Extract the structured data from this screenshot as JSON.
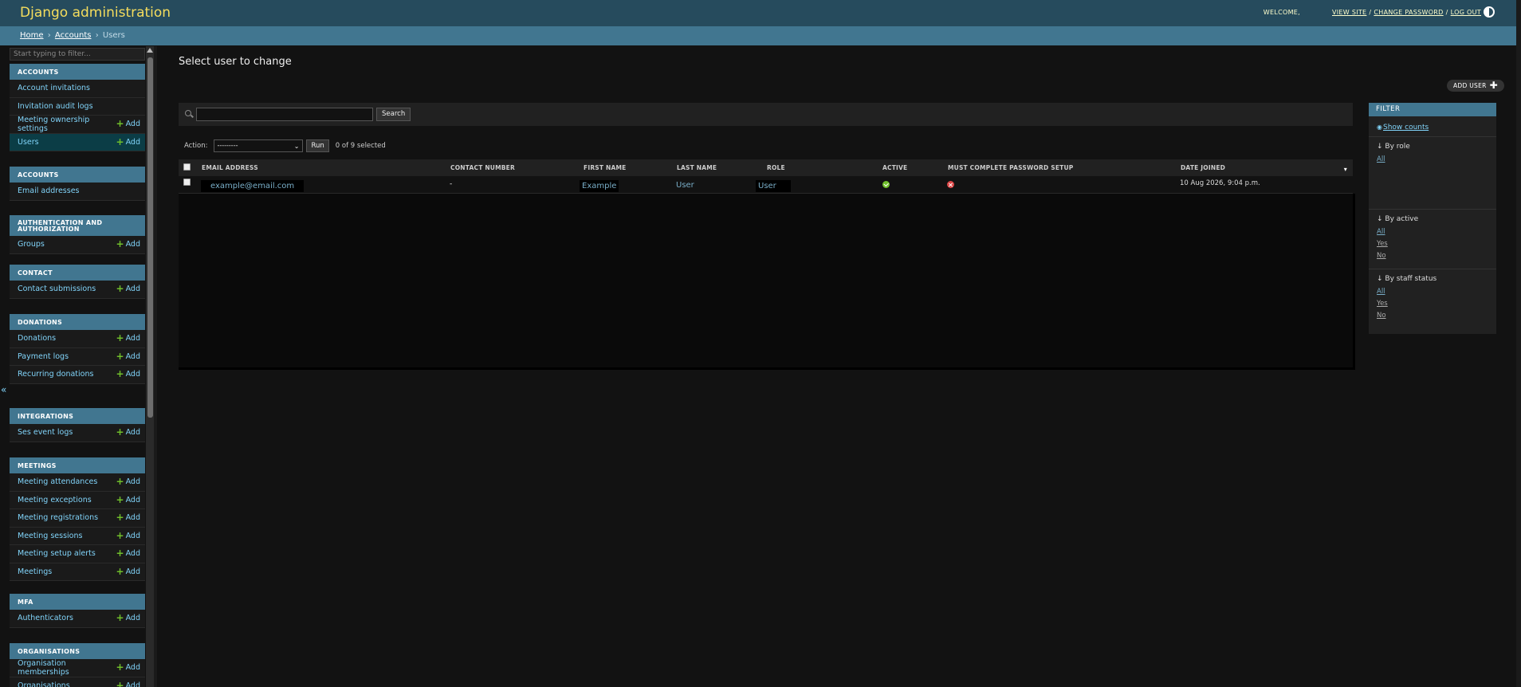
{
  "header": {
    "branding": "Django administration",
    "welcome": "WELCOME,",
    "view_site": "VIEW SITE",
    "change_password": "CHANGE PASSWORD",
    "log_out": "LOG OUT",
    "sep": "/"
  },
  "breadcrumbs": {
    "home": "Home",
    "accounts": "Accounts",
    "current": "Users",
    "arrow": "›"
  },
  "sidebar": {
    "filter_placeholder": "Start typing to filter...",
    "add_label": "Add",
    "toggle_icon": "«",
    "modules": [
      {
        "caption": "Accounts",
        "items": [
          {
            "label": "Account invitations",
            "add": false
          },
          {
            "label": "Invitation audit logs",
            "add": false
          },
          {
            "label": "Meeting ownership settings",
            "add": true
          },
          {
            "label": "Users",
            "add": true,
            "current": true
          }
        ]
      },
      {
        "caption": "Accounts",
        "items": [
          {
            "label": "Email addresses",
            "add": false
          }
        ]
      },
      {
        "caption": "Authentication and Authorization",
        "items": [
          {
            "label": "Groups",
            "add": true
          }
        ]
      },
      {
        "caption": "Contact",
        "items": [
          {
            "label": "Contact submissions",
            "add": true
          }
        ]
      },
      {
        "caption": "Donations",
        "items": [
          {
            "label": "Donations",
            "add": true
          },
          {
            "label": "Payment logs",
            "add": true
          },
          {
            "label": "Recurring donations",
            "add": true
          }
        ]
      },
      {
        "caption": "Integrations",
        "items": [
          {
            "label": "Ses event logs",
            "add": true
          }
        ]
      },
      {
        "caption": "Meetings",
        "items": [
          {
            "label": "Meeting attendances",
            "add": true
          },
          {
            "label": "Meeting exceptions",
            "add": true
          },
          {
            "label": "Meeting registrations",
            "add": true
          },
          {
            "label": "Meeting sessions",
            "add": true
          },
          {
            "label": "Meeting setup alerts",
            "add": true
          },
          {
            "label": "Meetings",
            "add": true
          }
        ]
      },
      {
        "caption": "MFA",
        "items": [
          {
            "label": "Authenticators",
            "add": true
          }
        ]
      },
      {
        "caption": "Organisations",
        "items": [
          {
            "label": "Organisation memberships",
            "add": true
          },
          {
            "label": "Organisations",
            "add": true
          }
        ]
      }
    ]
  },
  "content": {
    "title": "Select user to change",
    "add_user": "ADD USER",
    "search_button": "Search",
    "search_value": "",
    "action_label": "Action:",
    "action_selected": "---------",
    "run_button": "Run",
    "action_counter": "0 of 9 selected"
  },
  "table": {
    "headers": [
      "Email address",
      "Contact number",
      "First name",
      "Last name",
      "Role",
      "Active",
      "Must complete password setup",
      "Date joined"
    ],
    "rows": [
      {
        "email": "example@email.com",
        "contact": "-",
        "first_name": "Example",
        "last_name": "User",
        "role": "User",
        "active": true,
        "must_complete_password_setup": false,
        "date_joined": "10 Aug 2026, 9:04 p.m."
      }
    ]
  },
  "filter": {
    "title": "FILTER",
    "show_counts": "Show counts",
    "by_role": "↓ By role",
    "role_options": [
      "All"
    ],
    "by_active": "↓ By active",
    "active_options": [
      "All",
      "Yes",
      "No"
    ],
    "by_staff": "↓ By staff status",
    "staff_options": [
      "All",
      "Yes",
      "No"
    ]
  },
  "colors": {
    "header_bg": "#264b5d",
    "branding": "#f5dd5d",
    "breadcrumb_bg": "#417690",
    "link": "#81d4fa",
    "add_plus": "#70bf2b",
    "yes_icon": "#70bf2b",
    "no_icon": "#dd4646"
  }
}
